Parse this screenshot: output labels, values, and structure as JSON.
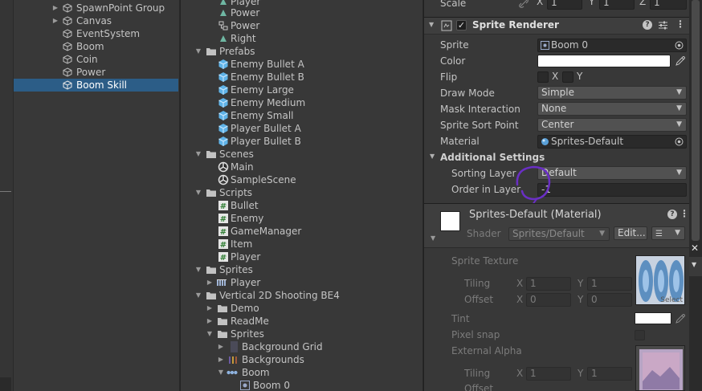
{
  "hierarchy": {
    "items": [
      {
        "label": "SpawnPoint Group",
        "expandable": true
      },
      {
        "label": "Canvas",
        "expandable": true
      },
      {
        "label": "EventSystem",
        "expandable": false
      },
      {
        "label": "Boom",
        "expandable": false
      },
      {
        "label": "Coin",
        "expandable": false
      },
      {
        "label": "Power",
        "expandable": false
      },
      {
        "label": "Boom Skill",
        "expandable": false,
        "selected": true
      }
    ]
  },
  "project": {
    "top_items": [
      "Player",
      "Power",
      "Power",
      "Right"
    ],
    "prefabs_label": "Prefabs",
    "prefabs": [
      "Enemy Bullet A",
      "Enemy Bullet B",
      "Enemy Large",
      "Enemy Medium",
      "Enemy Small",
      "Player Bullet A",
      "Player Bullet B"
    ],
    "scenes_label": "Scenes",
    "scenes": [
      "Main",
      "SampleScene"
    ],
    "scripts_label": "Scripts",
    "scripts": [
      "Bullet",
      "Enemy",
      "GameManager",
      "Item",
      "Player"
    ],
    "sprites_label": "Sprites",
    "sprites_child": "Player",
    "pack_label": "Vertical 2D Shooting BE4",
    "pack_children": [
      "Demo",
      "ReadMe"
    ],
    "pack_sprites_label": "Sprites",
    "pack_sprites_children": [
      "Background Grid",
      "Backgrounds"
    ],
    "boom_label": "Boom",
    "boom_child": "Boom 0"
  },
  "inspector": {
    "scale_label": "Scale",
    "scale_axes": [
      "X",
      "Y",
      "Z"
    ],
    "scale_values": [
      "1",
      "1",
      "1"
    ],
    "component_title": "Sprite Renderer",
    "sprite_label": "Sprite",
    "sprite_value": "Boom 0",
    "color_label": "Color",
    "flip_label": "Flip",
    "flip_x": "X",
    "flip_y": "Y",
    "draw_mode_label": "Draw Mode",
    "draw_mode_value": "Simple",
    "mask_label": "Mask Interaction",
    "mask_value": "None",
    "sort_point_label": "Sprite Sort Point",
    "sort_point_value": "Center",
    "material_label": "Material",
    "material_value": "Sprites-Default",
    "additional_label": "Additional Settings",
    "sorting_layer_label": "Sorting Layer",
    "sorting_layer_value": "Default",
    "order_label": "Order in Layer",
    "order_value": "-1",
    "material_title": "Sprites-Default (Material)",
    "shader_label": "Shader",
    "shader_value": "Sprites/Default",
    "edit_label": "Edit...",
    "sprite_texture_label": "Sprite Texture",
    "tiling_label": "Tiling",
    "offset_label": "Offset",
    "tiling_x": "1",
    "tiling_y": "1",
    "offset_x": "0",
    "offset_y": "0",
    "select_label": "Select",
    "tint_label": "Tint",
    "pixel_snap_label": "Pixel snap",
    "external_alpha_label": "External Alpha",
    "tiling2_x": "1",
    "tiling2_y": "1",
    "offset2_label": "Offset",
    "axis_x": "X",
    "axis_y": "Y"
  },
  "colors": {
    "selection": "#2c5d87",
    "annotation": "#6a2fc4",
    "panel": "#383838"
  }
}
